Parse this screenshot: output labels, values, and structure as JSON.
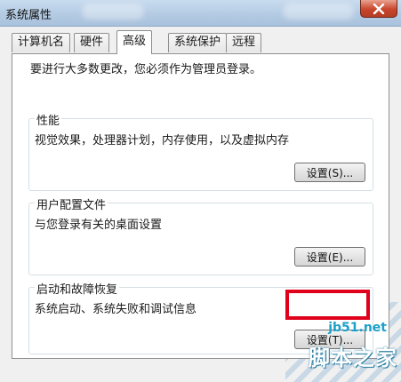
{
  "window": {
    "title": "系统属性"
  },
  "tabs": [
    {
      "label": "计算机名",
      "active": false
    },
    {
      "label": "硬件",
      "active": false
    },
    {
      "label": "高级",
      "active": true
    },
    {
      "label": "系统保护",
      "active": false
    },
    {
      "label": "远程",
      "active": false
    }
  ],
  "advanced": {
    "admin_note": "要进行大多数更改，您必须作为管理员登录。",
    "performance": {
      "label": "性能",
      "description": "视觉效果，处理器计划，内存使用，以及虚拟内存",
      "button": "设置(S)..."
    },
    "user_profiles": {
      "label": "用户配置文件",
      "description": "与您登录有关的桌面设置",
      "button": "设置(E)..."
    },
    "startup_recovery": {
      "label": "启动和故障恢复",
      "description": "系统启动、系统失败和调试信息",
      "button": "设置(T)..."
    }
  },
  "watermark": {
    "site": "jb51.net",
    "brand": "脚本之家"
  },
  "colors": {
    "highlight": "#e0001b",
    "close_button": "#c8452c"
  }
}
